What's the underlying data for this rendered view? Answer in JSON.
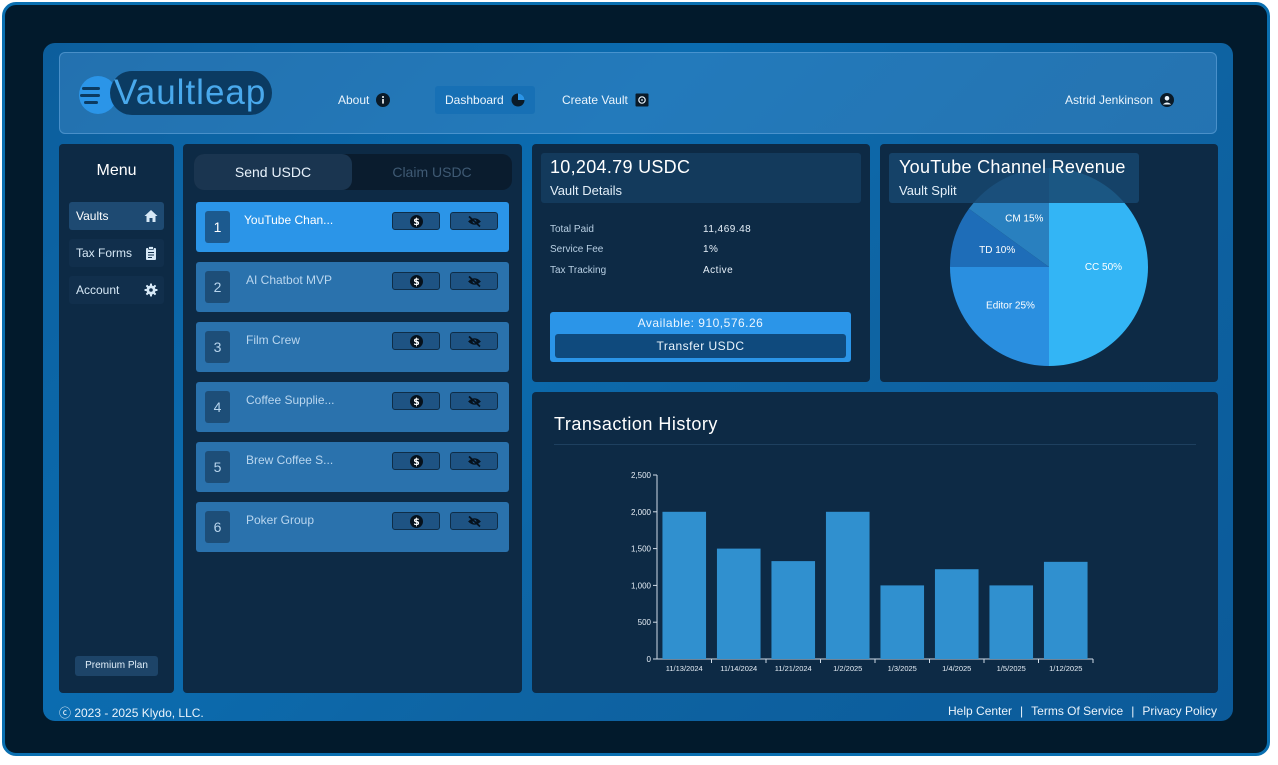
{
  "header": {
    "logo_text": "Vaultleap",
    "nav": [
      {
        "label": "About",
        "icon": "info-icon"
      },
      {
        "label": "Dashboard",
        "icon": "pie-chart-icon"
      },
      {
        "label": "Create Vault",
        "icon": "vault-icon"
      }
    ],
    "user_name": "Astrid Jenkinson",
    "user_icon": "user-icon"
  },
  "menu": {
    "title": "Menu",
    "items": [
      {
        "label": "Vaults",
        "icon": "home-icon"
      },
      {
        "label": "Tax Forms",
        "icon": "clipboard-icon"
      },
      {
        "label": "Account",
        "icon": "gear-icon"
      }
    ],
    "premium_label": "Premium Plan"
  },
  "vault_tabs": {
    "send": "Send USDC",
    "claim": "Claim USDC"
  },
  "vaults": [
    {
      "num": "1",
      "name": "YouTube Chan..."
    },
    {
      "num": "2",
      "name": "AI Chatbot MVP"
    },
    {
      "num": "3",
      "name": "Film Crew"
    },
    {
      "num": "4",
      "name": "Coffee Supplie..."
    },
    {
      "num": "5",
      "name": "Brew Coffee S..."
    },
    {
      "num": "6",
      "name": "Poker Group"
    }
  ],
  "vault_details": {
    "amount": "10,204.79 USDC",
    "subtitle": "Vault Details",
    "rows": [
      {
        "label": "Total Paid",
        "value": "11,469.48"
      },
      {
        "label": "Service Fee",
        "value": "1%"
      },
      {
        "label": "Tax Tracking",
        "value": "Active"
      }
    ],
    "available": "Available: 910,576.26",
    "transfer_label": "Transfer USDC"
  },
  "vault_split": {
    "title": "YouTube Channel Revenue",
    "subtitle": "Vault Split"
  },
  "history": {
    "title": "Transaction History"
  },
  "colors": {
    "accent": "#2b95e8",
    "bar": "#3090cf",
    "pie_cc": "#33b5f5",
    "pie_editor": "#2a8fe0",
    "pie_td": "#1e6db8",
    "pie_cm": "#2980bf"
  },
  "chart_data": [
    {
      "type": "pie",
      "title": "YouTube Channel Revenue",
      "subtitle": "Vault Split",
      "slices": [
        {
          "label": "CC 50%",
          "value": 50
        },
        {
          "label": "Editor 25%",
          "value": 25
        },
        {
          "label": "TD 10%",
          "value": 10
        },
        {
          "label": "CM 15%",
          "value": 15
        }
      ]
    },
    {
      "type": "bar",
      "title": "Transaction History",
      "categories": [
        "11/13/2024",
        "11/14/2024",
        "11/21/2024",
        "1/2/2025",
        "1/3/2025",
        "1/4/2025",
        "1/5/2025",
        "1/12/2025"
      ],
      "values": [
        2000,
        1500,
        1330,
        2000,
        1000,
        1220,
        1000,
        1320
      ],
      "ylim": [
        0,
        2500
      ],
      "yticks": [
        0,
        500,
        1000,
        1500,
        2000,
        2500
      ],
      "ytick_labels": [
        "0",
        "500",
        "1,000",
        "1,500",
        "2,000",
        "2,500"
      ],
      "grid": false
    }
  ],
  "footer": {
    "copyright": "ⓒ 2023 - 2025 Klydo, LLC.",
    "links": [
      "Help Center",
      "Terms Of Service",
      "Privacy Policy"
    ]
  }
}
